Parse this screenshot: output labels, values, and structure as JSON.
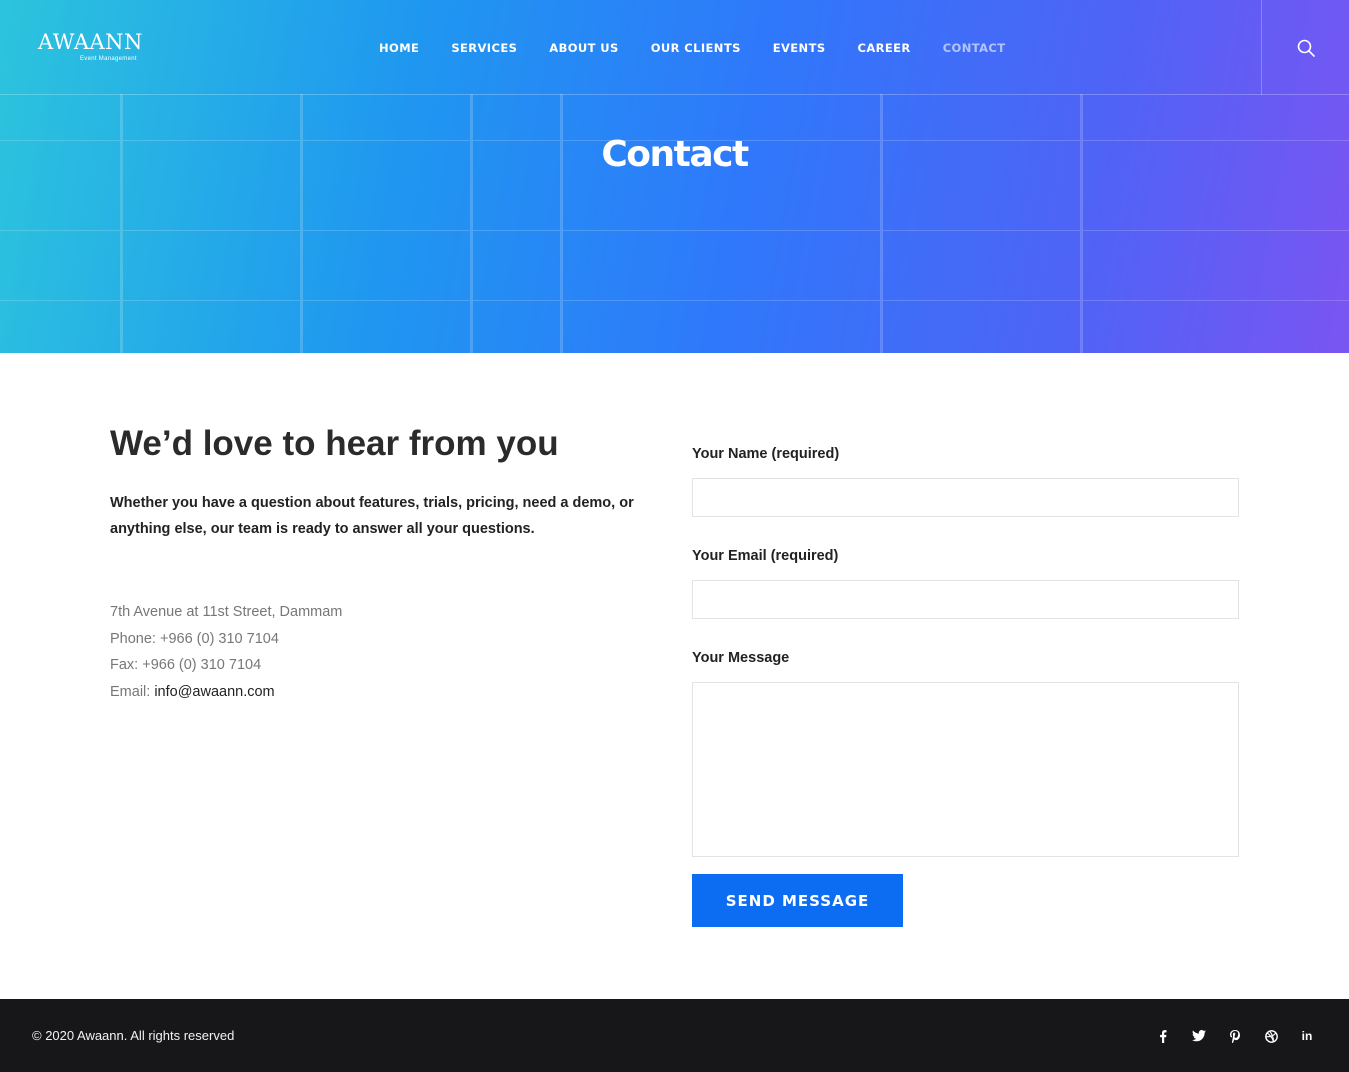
{
  "brand": {
    "name": "AWAANN",
    "tagline": "Event Management"
  },
  "nav": {
    "items": [
      {
        "label": "HOME",
        "active": false
      },
      {
        "label": "SERVICES",
        "active": false
      },
      {
        "label": "ABOUT US",
        "active": false
      },
      {
        "label": "OUR CLIENTS",
        "active": false
      },
      {
        "label": "EVENTS",
        "active": false
      },
      {
        "label": "CAREER",
        "active": false
      },
      {
        "label": "CONTACT",
        "active": true
      }
    ],
    "search_icon": "search-icon"
  },
  "hero": {
    "title": "Contact"
  },
  "intro": {
    "heading": "We’d love to hear from you",
    "text": "Whether you have a question about features, trials, pricing, need a demo, or anything else, our team is ready to answer all your questions."
  },
  "contact": {
    "address": "7th Avenue at 11st Street, Dammam",
    "phone": "Phone: +966 (0) 310 7104",
    "fax": "Fax: +966 (0) 310 7104",
    "email_label": "Email: ",
    "email": "info@awaann.com"
  },
  "form": {
    "name_label": "Your Name (required)",
    "name_value": "",
    "email_label": "Your Email (required)",
    "email_value": "",
    "message_label": "Your Message",
    "message_value": "",
    "submit_label": "SEND MESSAGE"
  },
  "footer": {
    "copyright": "© 2020 Awaann. All rights reserved",
    "social_icons": [
      "facebook-icon",
      "twitter-icon",
      "pinterest-icon",
      "dribbble-icon",
      "linkedin-icon"
    ],
    "linkedin_text": "in"
  },
  "colors": {
    "accent": "#0c6cf2",
    "footer_bg": "#17171a",
    "hero_start": "#2cc4dd",
    "hero_end": "#7a55f2"
  }
}
